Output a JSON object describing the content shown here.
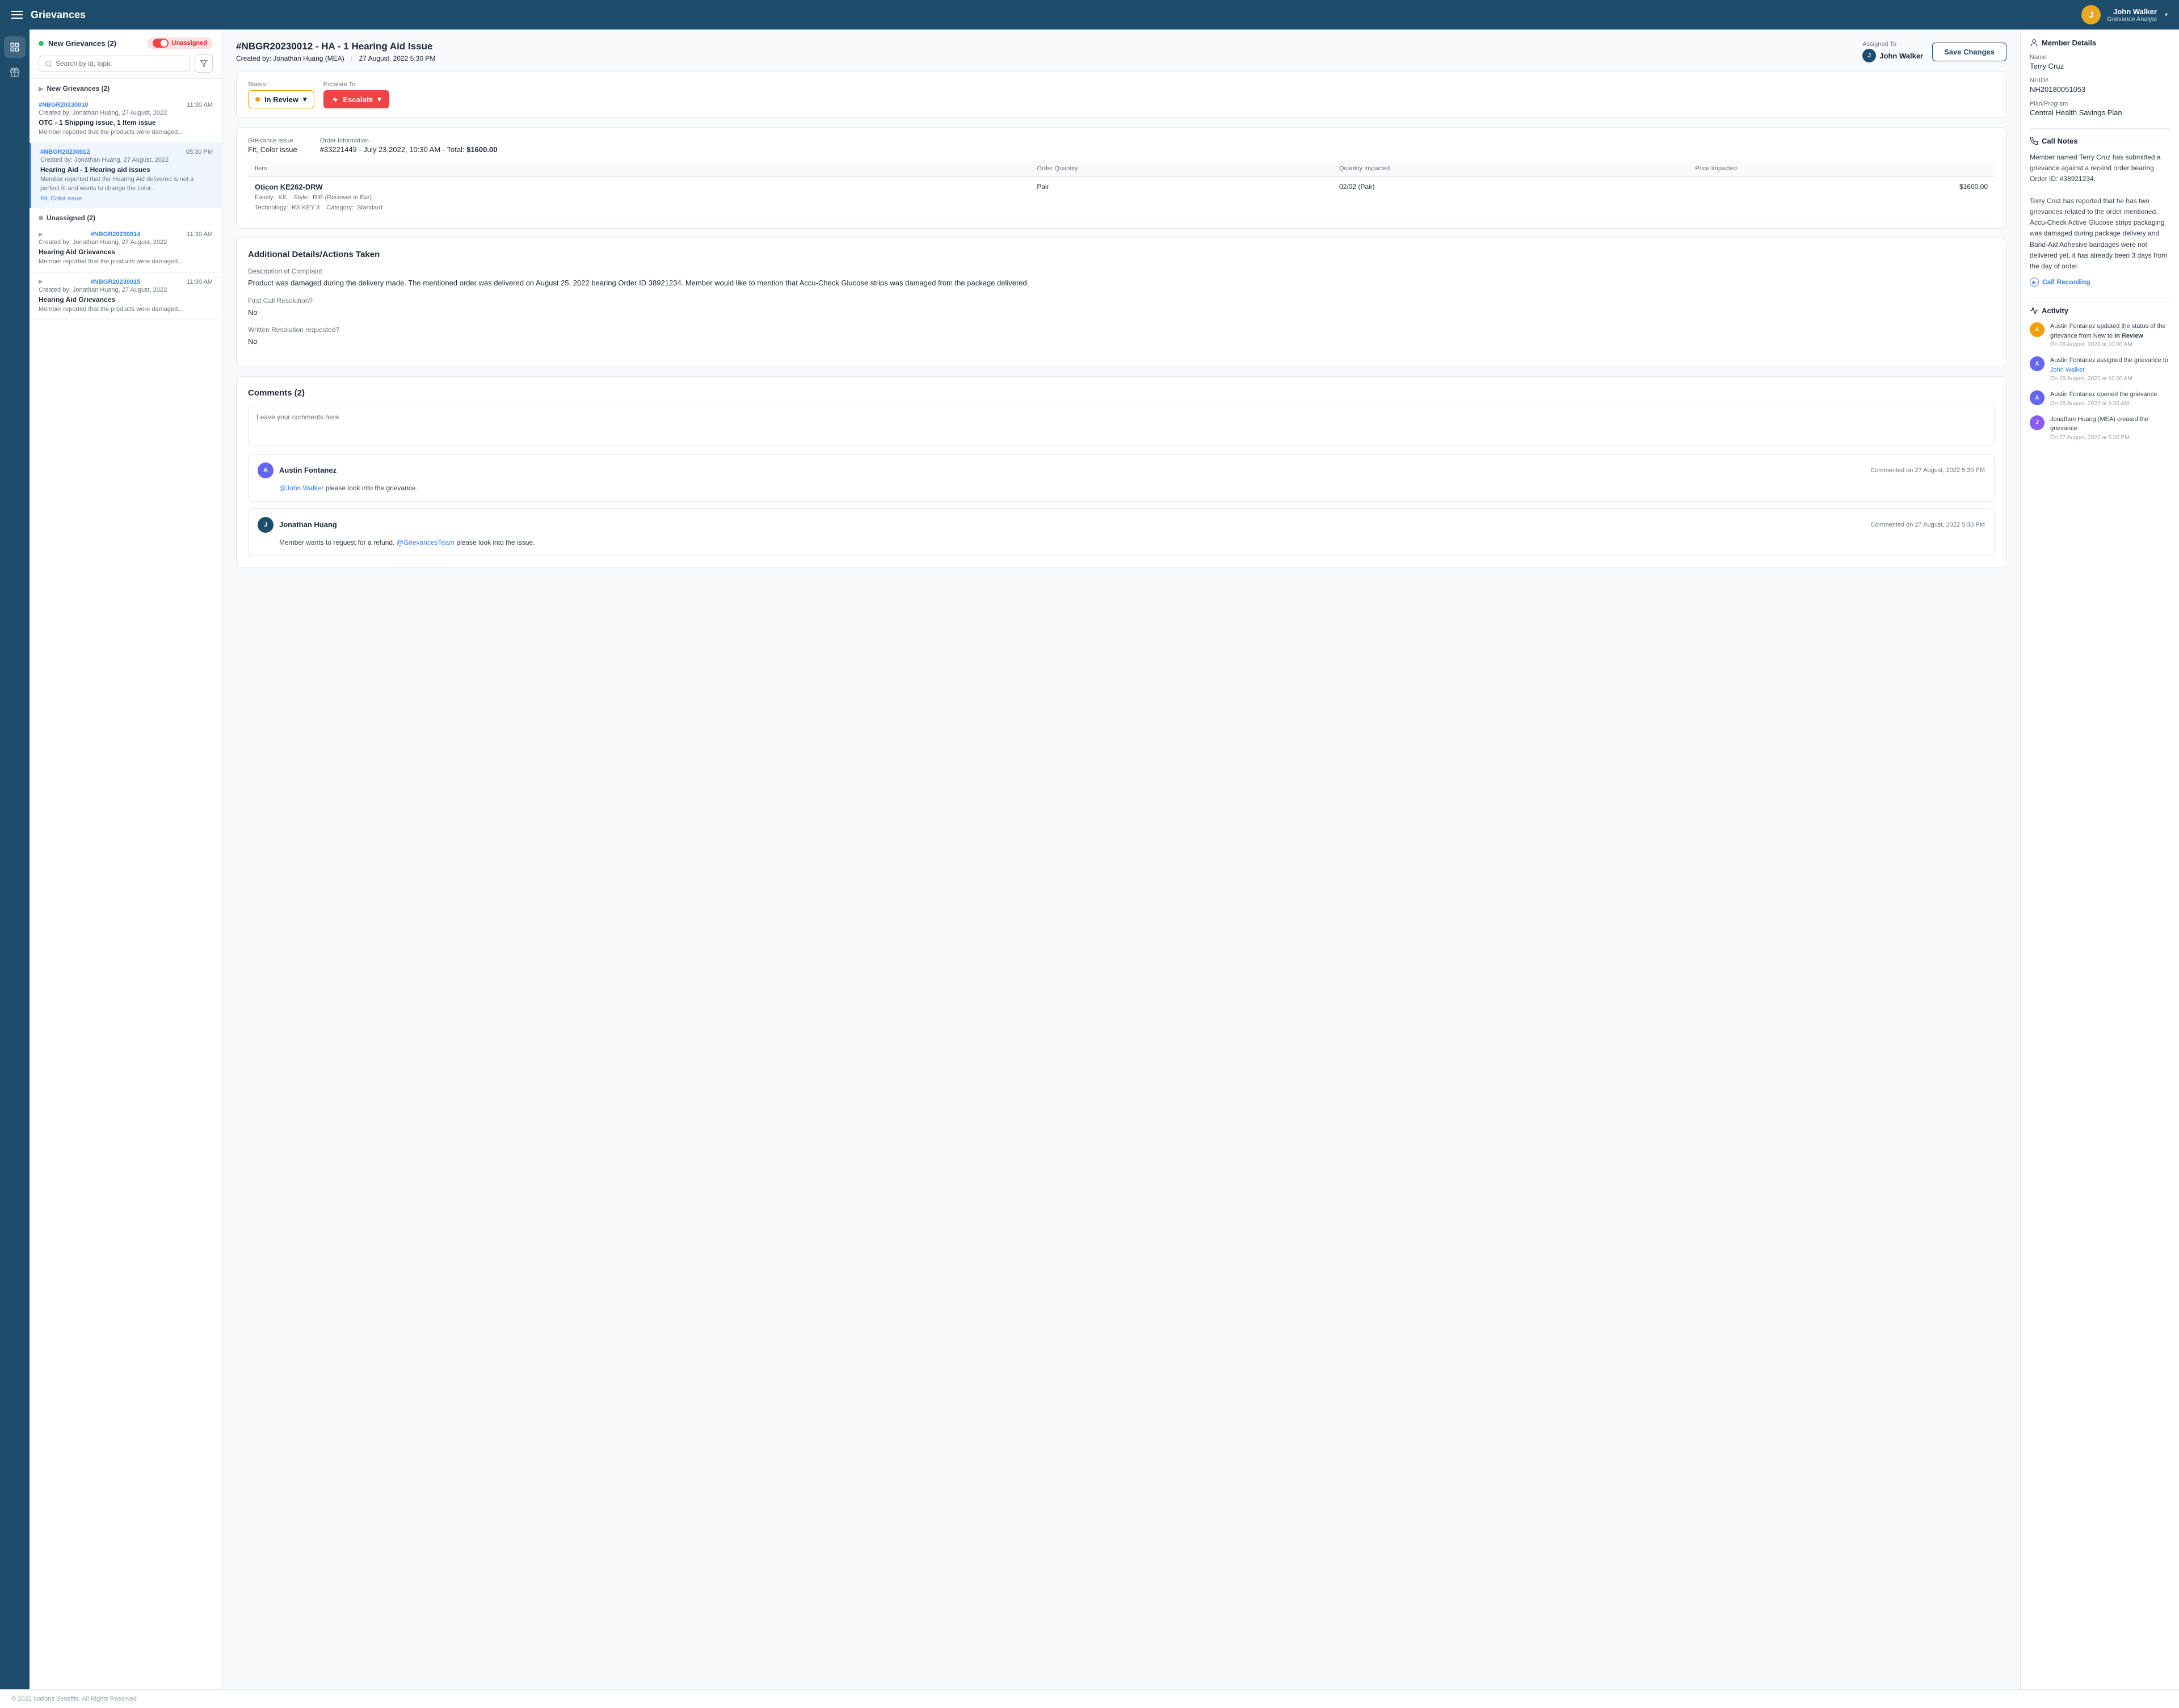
{
  "app": {
    "title": "Grievances",
    "footer": "© 2022 Nations Benefits. All Rights Reserved"
  },
  "user": {
    "name": "John Walker",
    "role": "Grievance Analyst",
    "avatar_initial": "J"
  },
  "sidebar_icons": [
    "grid",
    "tag"
  ],
  "list_panel": {
    "new_grievances_label": "New Grievances (2)",
    "unassigned_label": "Unassigned",
    "search_placeholder": "Search by id, topic",
    "sections": [
      {
        "label": "New Grievances (2)",
        "type": "new",
        "items": [
          {
            "id": "#NBGR20230010",
            "time": "11:30 AM",
            "created": "Created by: Jonathan Huang, 27 August, 2022",
            "title": "OTC - 1 Shipping issue, 1 Item issue",
            "desc": "Member reported that the products were damaged...",
            "tag": null,
            "selected": false
          },
          {
            "id": "#NBGR20230012",
            "time": "05:30 PM",
            "created": "Created by: Jonathan Huang, 27 August, 2022",
            "title": "Hearing Aid - 1 Hearing aid issues",
            "desc": "Member reported that the Hearing Aid delivered is not a perfect fit and wants to change the color...",
            "tag": "Fit, Color issue",
            "selected": true
          }
        ]
      },
      {
        "label": "Unassigned (2)",
        "type": "unassigned",
        "items": [
          {
            "id": "#NBGR20230014",
            "time": "11:30 AM",
            "created": "Created by: Jonathan Huang, 27 August, 2022",
            "title": "Hearing Aid Grievances",
            "desc": "Member reported that the products were damaged...",
            "tag": null,
            "selected": false
          },
          {
            "id": "#NBGR20230015",
            "time": "11:30 AM",
            "created": "Created by: Jonathan Huang, 27 August, 2022",
            "title": "Hearing Aid Grievances",
            "desc": "Member reported that the products were damaged...",
            "tag": null,
            "selected": false
          }
        ]
      }
    ]
  },
  "main": {
    "grievance_id": "#NBGR20230012 - HA - 1 Hearing Aid Issue",
    "created_by": "Jonathan Huang (MEA)",
    "created_date": "27 August, 2022  5:30 PM",
    "assigned_to_label": "Assigned To",
    "assigned_to": "John Walker",
    "assigned_avatar": "J",
    "save_button": "Save Changes",
    "status_label": "Status:",
    "status_value": "In Review",
    "escalate_label": "Escalate To:",
    "escalate_button": "Escalate",
    "grievance_issue_label": "Grievance Issue",
    "grievance_issue_value": "Fit, Color issue",
    "order_info_label": "Order Information",
    "order_info_value": "#33221449 - July 23,2022, 10:30 AM - Total: $1600.00",
    "table": {
      "headers": [
        "Item",
        "Order Quantity",
        "Quantity Impacted",
        "Price Impacted"
      ],
      "rows": [
        {
          "name": "Oticon KE262-DRW",
          "details_line1": "Family:  KE    Style:  RIE (Receiver in Ear)",
          "details_line2": "Technology:  RS KEY 3    Category:  Standard",
          "order_qty": "Pair",
          "qty_impacted": "02/02 (Pair)",
          "price_impacted": "$1600.00"
        }
      ]
    },
    "additional_title": "Additional Details/Actions Taken",
    "description_label": "Description of Complaint",
    "description_value": "Product was damaged during the delivery made. The mentioned order was delivered on August 25, 2022 bearing Order ID 38921234. Member would like to mention that Accu-Check Glucose strips was damaged from the package delivered.",
    "first_call_label": "First Call Resolution?",
    "first_call_value": "No",
    "written_label": "Written Resolution requested?",
    "written_value": "No",
    "comments_title": "Comments (2)",
    "comment_placeholder": "Leave your comments here",
    "comments": [
      {
        "author": "Austin Fontanez",
        "avatar_initial": "A",
        "avatar_color": "#6366f1",
        "time": "Commented on 27 August, 2022  5:30 PM",
        "text": "@John Walker please look into the grievance.",
        "mention": "@John Walker",
        "mention_rest": " please look into the grievance."
      },
      {
        "author": "Jonathan Huang",
        "avatar_initial": "J",
        "avatar_color": "#1e4d6b",
        "time": "Commented on 27 August, 2022  5:30 PM",
        "text": "Member wants to request for a refund. @GrievancesTeam please look into the issue.",
        "mention": "@GrievancesTeam",
        "prefix": "Member wants to request for a refund. ",
        "suffix": " please look into the issue."
      }
    ]
  },
  "right_panel": {
    "member_details_title": "Member Details",
    "name_label": "Name",
    "name_value": "Terry Cruz",
    "nhid_label": "NHID#",
    "nhid_value": "NH20180051053",
    "plan_label": "Plan/Program",
    "plan_value": "Central Health Savings Plan",
    "call_notes_title": "Call Notes",
    "call_notes_text": "Member named Terry Cruz has submitted a grievance against a recend order bearing Order ID: #38921234.\n\nTerry Cruz has reported that he has two grievances related to the order mentioned. Accu-Check Active Glucose strips packaging was damaged during package delivery and Band-Aid Adhesive bandages were not delivered yet, it has already been 3 days from the day of order.",
    "call_recording_label": "Call Recording",
    "activity_title": "Activity",
    "activities": [
      {
        "avatar_initial": "A",
        "avatar_color": "#f59e0b",
        "text": "Austin Fontanez updated the status of the grievance from New to In Review",
        "time": "On 28 August, 2022 at 10:00 AM"
      },
      {
        "avatar_initial": "A",
        "avatar_color": "#6366f1",
        "text": "Austin Fontanez assigned the grievance to John Walker",
        "time": "On 28 August, 2022 at 10:00 AM",
        "has_link": true,
        "link_text": "John Walker"
      },
      {
        "avatar_initial": "A",
        "avatar_color": "#6366f1",
        "text": "Austin Fontanez opened the grievance",
        "time": "On 28 August, 2022 at 9:30 AM"
      },
      {
        "avatar_initial": "J",
        "avatar_color": "#8b5cf6",
        "text": "Jonathan Huang (MEA) created the grievance",
        "time": "On 27 August, 2022 at 5:30 PM"
      }
    ]
  }
}
